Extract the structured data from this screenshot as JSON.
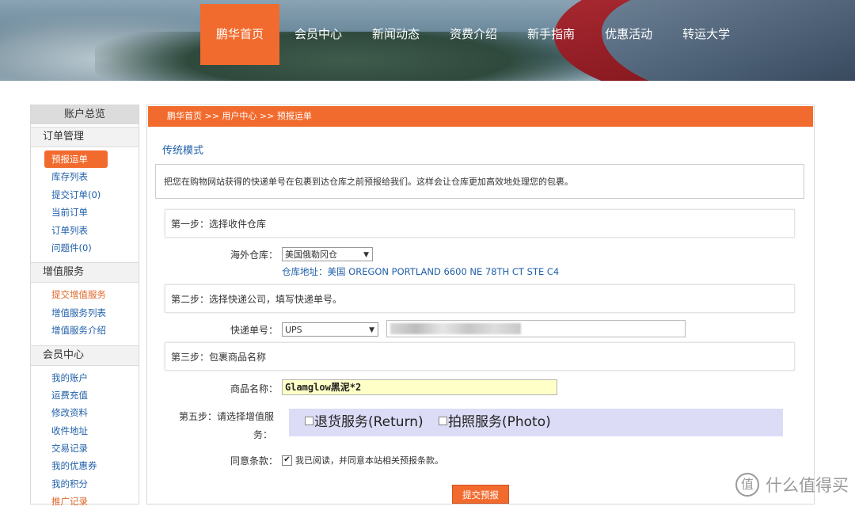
{
  "nav": {
    "items": [
      "鹏华首页",
      "会员中心",
      "新闻动态",
      "资费介绍",
      "新手指南",
      "优惠活动",
      "转运大学"
    ],
    "active_index": 0
  },
  "sidebar": {
    "title": "账户总览",
    "sections": [
      {
        "label": "订单管理",
        "links": [
          "预报运单",
          "库存列表",
          "提交订单(0)",
          "当前订单",
          "订单列表",
          "问题件(0)"
        ]
      },
      {
        "label": "增值服务",
        "links": [
          "提交增值服务",
          "增值服务列表",
          "增值服务介绍"
        ]
      },
      {
        "label": "会员中心",
        "links": [
          "我的账户",
          "运费充值",
          "修改资料",
          "收件地址",
          "交易记录",
          "我的优惠券",
          "我的积分",
          "推广记录"
        ]
      }
    ]
  },
  "main": {
    "breadcrumb": "鹏华首页 >> 用户中心 >> 预报运单",
    "mode_title": "传统模式",
    "notice": "把您在购物网站获得的快递单号在包裹到达仓库之前预报给我们。这样会让仓库更加高效地处理您的包裹。",
    "step1": "第一步：选择收件仓库",
    "warehouse_label": "海外仓库：",
    "warehouse_value": "美国俄勒冈仓",
    "warehouse_address": "仓库地址：美国 OREGON PORTLAND 6600 NE 78TH CT STE C4",
    "step2": "第二步：选择快递公司，填写快递单号。",
    "tracking_label": "快递单号：",
    "carrier_value": "UPS",
    "step3": "第三步：包裹商品名称",
    "product_label": "商品名称：",
    "product_value": "Glamglow黑泥*2",
    "step5_label_line1": "第五步：请选择增值服",
    "step5_label_line2": "务：",
    "vas_return": "退货服务(Return)",
    "vas_photo": "拍照服务(Photo)",
    "agree_label": "同意条款：",
    "agree_text": "我已阅读，并同意本站相关预报条款。",
    "agree_checked": true,
    "submit_label": "提交预报"
  },
  "watermark": {
    "logo": "值",
    "text": "什么值得买"
  },
  "colors": {
    "accent": "#f26b2e",
    "link": "#1f5fa8",
    "highlight_input": "#ffffc8",
    "vas_box": "#dcdcf7"
  }
}
